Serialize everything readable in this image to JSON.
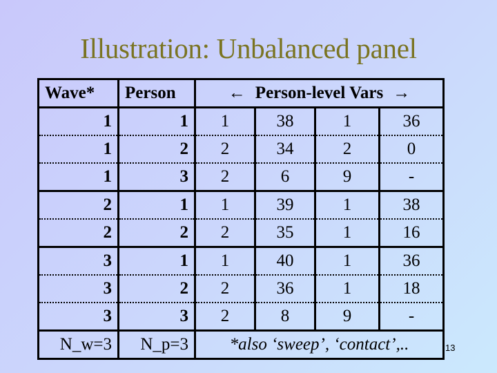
{
  "slide": {
    "title": "Illustration: Unbalanced panel",
    "page_number": "13"
  },
  "table": {
    "headers": {
      "wave": "Wave*",
      "person": "Person",
      "vars_left_arrow": "←",
      "vars_label": "Person-level Vars",
      "vars_right_arrow": "→"
    },
    "rows": [
      {
        "wave": "1",
        "person": "1",
        "v1": "1",
        "v2": "38",
        "v3": "1",
        "v4": "36",
        "sep": "dotted"
      },
      {
        "wave": "1",
        "person": "2",
        "v1": "2",
        "v2": "34",
        "v3": "2",
        "v4": "0",
        "sep": "dotted"
      },
      {
        "wave": "1",
        "person": "3",
        "v1": "2",
        "v2": "6",
        "v3": "9",
        "v4": "-",
        "sep": "solid"
      },
      {
        "wave": "2",
        "person": "1",
        "v1": "1",
        "v2": "39",
        "v3": "1",
        "v4": "38",
        "sep": "dotted"
      },
      {
        "wave": "2",
        "person": "2",
        "v1": "2",
        "v2": "35",
        "v3": "1",
        "v4": "16",
        "sep": "solid"
      },
      {
        "wave": "3",
        "person": "1",
        "v1": "1",
        "v2": "40",
        "v3": "1",
        "v4": "36",
        "sep": "dotted"
      },
      {
        "wave": "3",
        "person": "2",
        "v1": "2",
        "v2": "36",
        "v3": "1",
        "v4": "18",
        "sep": "dotted"
      },
      {
        "wave": "3",
        "person": "3",
        "v1": "2",
        "v2": "8",
        "v3": "9",
        "v4": "-",
        "sep": "solid"
      }
    ],
    "footer": {
      "n_waves": "N_w=3",
      "n_persons": "N_p=3",
      "note": "*also ‘sweep’, ‘contact’,.."
    }
  }
}
